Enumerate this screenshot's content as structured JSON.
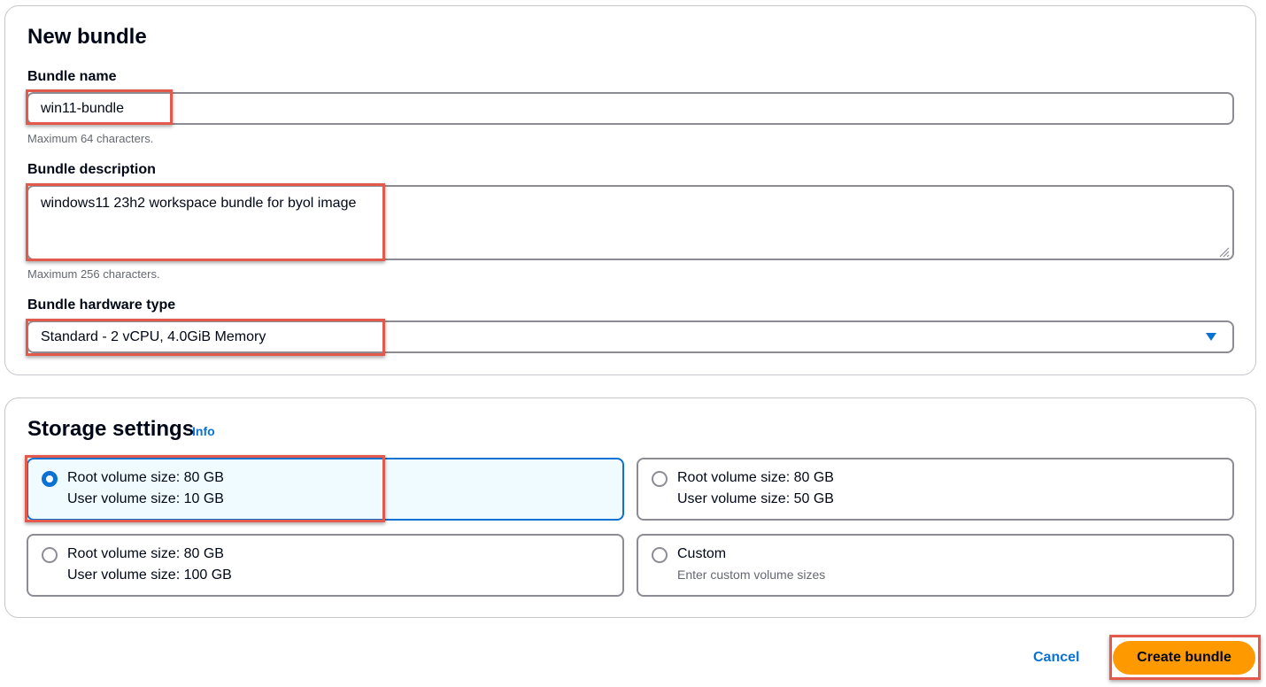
{
  "bundle": {
    "title": "New bundle",
    "name": {
      "label": "Bundle name",
      "value": "win11-bundle",
      "hint": "Maximum 64 characters."
    },
    "description": {
      "label": "Bundle description",
      "value": "windows11 23h2 workspace bundle for byol image",
      "hint": "Maximum 256 characters."
    },
    "hardware": {
      "label": "Bundle hardware type",
      "selected": "Standard - 2 vCPU, 4.0GiB Memory"
    }
  },
  "storage": {
    "title": "Storage settings",
    "info_label": "Info",
    "options": [
      {
        "line1": "Root volume size: 80 GB",
        "line2": "User volume size: 10 GB",
        "selected": true
      },
      {
        "line1": "Root volume size: 80 GB",
        "line2": "User volume size: 50 GB",
        "selected": false
      },
      {
        "line1": "Root volume size: 80 GB",
        "line2": "User volume size: 100 GB",
        "selected": false
      },
      {
        "line1": "Custom",
        "line2": "Enter custom volume sizes",
        "selected": false
      }
    ]
  },
  "actions": {
    "cancel_label": "Cancel",
    "create_label": "Create bundle"
  },
  "colors": {
    "accent": "#0972d3",
    "primary_button": "#ff9900",
    "highlight": "#e3594c",
    "selected_tile_bg": "#f0fbff"
  },
  "icons": {
    "select_caret": "caret-down-icon",
    "resize": "resize-grip-icon"
  }
}
